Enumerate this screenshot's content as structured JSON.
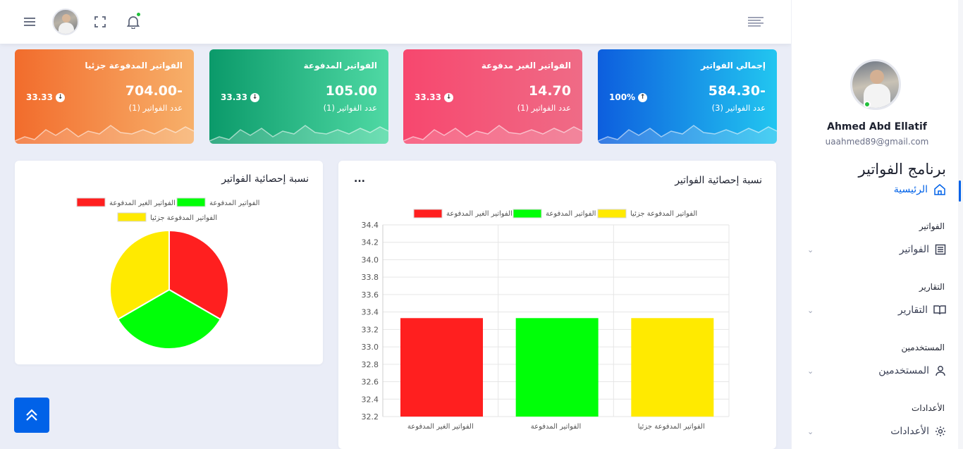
{
  "topbar": {
    "icons": [
      "menu-icon",
      "fullscreen-icon",
      "bell-icon",
      "lines-icon"
    ]
  },
  "sidebar": {
    "profile": {
      "name": "Ahmed Abd Ellatif",
      "email": "uaahmed89@gmail.com"
    },
    "app_title": "برنامج الفواتير",
    "home_label": "الرئيسية",
    "sections": [
      {
        "category": "الفواتير",
        "label": "الفواتير",
        "icon": "invoice-icon"
      },
      {
        "category": "التقارير",
        "label": "التقارير",
        "icon": "book-icon"
      },
      {
        "category": "المستخدمين",
        "label": "المستخدمين",
        "icon": "user-icon"
      },
      {
        "category": "الأعدادات",
        "label": "الأعدادات",
        "icon": "gear-icon"
      }
    ]
  },
  "cards": [
    {
      "title": "إجمالي الفواتير",
      "value": "584.30-",
      "count": "عدد الفواتير (3)",
      "percent": "100%",
      "direction": "up",
      "color_from": "#0d5ede",
      "color_to": "#22c6f0"
    },
    {
      "title": "الفواتير الغير مدفوعة",
      "value": "14.70",
      "count": "عدد الفواتير (1)",
      "percent": "33.33",
      "direction": "down",
      "color_from": "#f7476e",
      "color_to": "#ef6b86"
    },
    {
      "title": "الفواتير المدفوعة",
      "value": "105.00",
      "count": "عدد الفواتير (1)",
      "percent": "33.33",
      "direction": "down",
      "color_from": "#0b9a6a",
      "color_to": "#4fd9a4"
    },
    {
      "title": "الفواتير المدفوعة جزئيا",
      "value": "704.00-",
      "count": "عدد الفواتير (1)",
      "percent": "33.33",
      "direction": "down",
      "color_from": "#f26c2c",
      "color_to": "#f7b06a"
    }
  ],
  "bar_panel": {
    "title": "نسبة إحصائية الفواتير",
    "menu": "..."
  },
  "pie_panel": {
    "title": "نسبة إحصائية الفواتير"
  },
  "chart_data": [
    {
      "type": "bar",
      "categories": [
        "الفواتير الغير المدفوعة",
        "الفواتير المدفوعة",
        "الفواتير المدفوعة جزئيا"
      ],
      "series": [
        {
          "name": "الفواتير الغير المدفوعة",
          "values": [
            33.33,
            null,
            null
          ],
          "color": "#ff1f1f"
        },
        {
          "name": "الفواتير المدفوعة",
          "values": [
            null,
            33.33,
            null
          ],
          "color": "#00ff08"
        },
        {
          "name": "الفواتير المدفوعة جزئيا",
          "values": [
            null,
            null,
            33.33
          ],
          "color": "#ffea00"
        }
      ],
      "yticks": [
        "34.4",
        "34.2",
        "34.0",
        "33.8",
        "33.6",
        "33.4",
        "33.2",
        "33.0",
        "32.8",
        "32.6",
        "32.4",
        "32.2"
      ],
      "ylim": [
        32.2,
        34.4
      ],
      "grid": true,
      "legend": "top"
    },
    {
      "type": "pie",
      "labels": [
        "الفواتير الغير المدفوعة",
        "الفواتير المدفوعة",
        "الفواتير المدفوعة جزئيا"
      ],
      "values": [
        33.33,
        33.33,
        33.33
      ],
      "colors": [
        "#ff1f1f",
        "#00ff08",
        "#ffea00"
      ],
      "legend": "top"
    }
  ]
}
